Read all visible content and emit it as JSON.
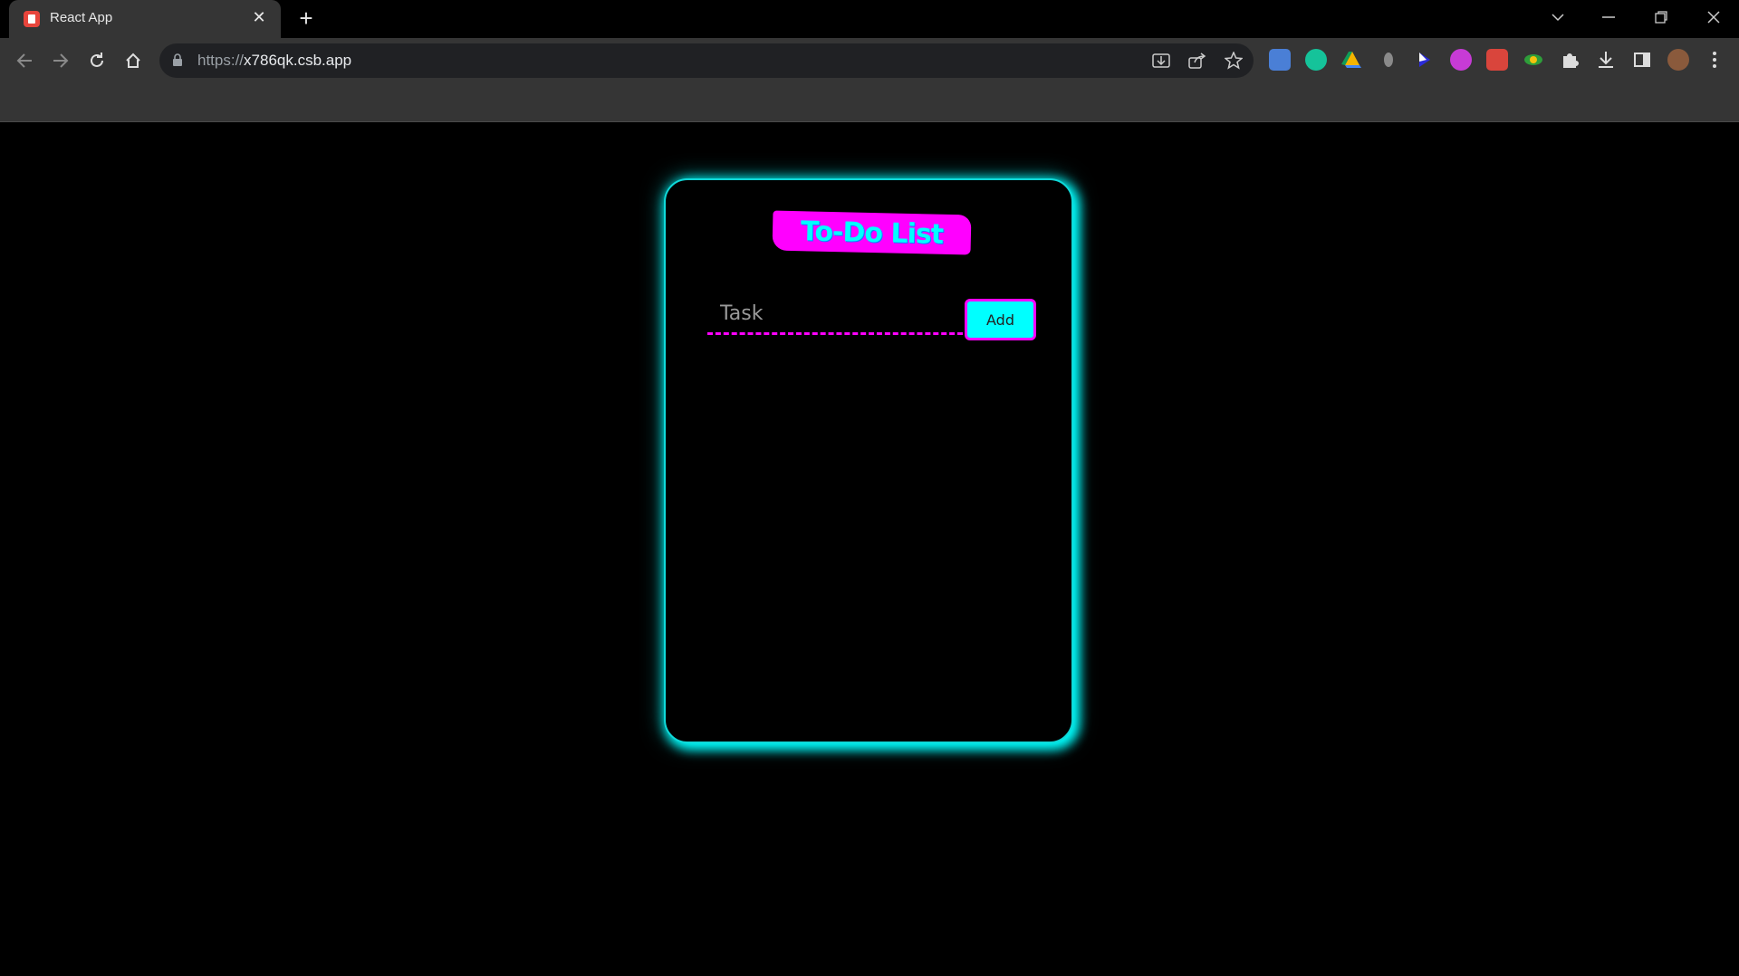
{
  "browser": {
    "tab_title": "React App",
    "url_scheme": "https://",
    "url_host": "x786qk.csb.app"
  },
  "app": {
    "title": "To-Do List",
    "input_placeholder": "Task",
    "add_label": "Add"
  },
  "colors": {
    "accent_magenta": "#ff00ff",
    "accent_cyan": "#00ffff",
    "background": "#000000"
  }
}
